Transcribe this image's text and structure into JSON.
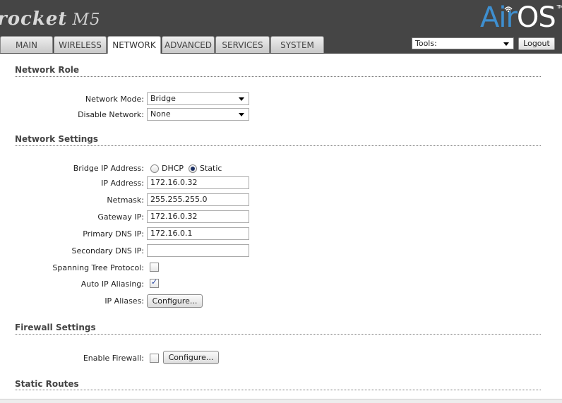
{
  "header": {
    "brand": "rocket",
    "model": "M5",
    "os_prefix": "Air",
    "os_suffix": "OS",
    "trademark": "TM"
  },
  "tabs": [
    {
      "label": "MAIN"
    },
    {
      "label": "WIRELESS"
    },
    {
      "label": "NETWORK"
    },
    {
      "label": "ADVANCED"
    },
    {
      "label": "SERVICES"
    },
    {
      "label": "SYSTEM"
    }
  ],
  "active_tab": "NETWORK",
  "toolbar": {
    "tools_value": "Tools:",
    "logout_label": "Logout"
  },
  "network_role": {
    "title": "Network Role",
    "network_mode_label": "Network Mode:",
    "network_mode_value": "Bridge",
    "disable_network_label": "Disable Network:",
    "disable_network_value": "None"
  },
  "network_settings": {
    "title": "Network Settings",
    "bridge_ip_label": "Bridge IP Address:",
    "dhcp_label": "DHCP",
    "static_label": "Static",
    "selected_mode": "Static",
    "ip_address_label": "IP Address:",
    "ip_address_value": "172.16.0.32",
    "netmask_label": "Netmask:",
    "netmask_value": "255.255.255.0",
    "gateway_label": "Gateway IP:",
    "gateway_value": "172.16.0.32",
    "primary_dns_label": "Primary DNS IP:",
    "primary_dns_value": "172.16.0.1",
    "secondary_dns_label": "Secondary DNS IP:",
    "secondary_dns_value": "",
    "stp_label": "Spanning Tree Protocol:",
    "stp_checked": false,
    "auto_alias_label": "Auto IP Aliasing:",
    "auto_alias_checked": true,
    "ip_aliases_label": "IP Aliases:",
    "configure_label": "Configure..."
  },
  "firewall_settings": {
    "title": "Firewall Settings",
    "enable_label": "Enable Firewall:",
    "enable_checked": false,
    "configure_label": "Configure..."
  },
  "static_routes": {
    "title": "Static Routes"
  },
  "colors": {
    "header_bg": "#454545",
    "accent_blue": "#3e8fd0"
  }
}
